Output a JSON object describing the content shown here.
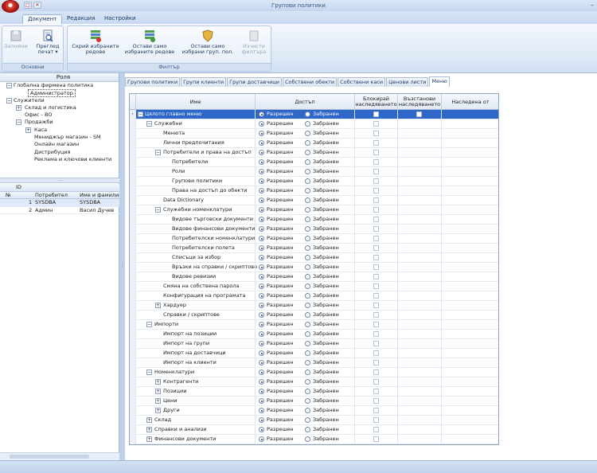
{
  "window": {
    "title": "Групови политики"
  },
  "ribbon": {
    "tabs": [
      "Документ",
      "Редакция",
      "Настройки"
    ],
    "groups": [
      {
        "label": "Основни",
        "buttons": [
          {
            "label": "Запомни",
            "disabled": true
          },
          {
            "label": "Преглед печат ▾",
            "disabled": false
          }
        ]
      },
      {
        "label": "Филтър",
        "buttons": [
          {
            "label": "Скрий избраните редове",
            "disabled": false
          },
          {
            "label": "Остави само избраните редове",
            "disabled": false
          },
          {
            "label": "Остави само избрани груп. пол.",
            "disabled": false
          },
          {
            "label": "Изчисти филтъра",
            "disabled": true
          }
        ]
      }
    ]
  },
  "left": {
    "header": "Роля",
    "tree": [
      {
        "label": "Глобална фирмена политика",
        "level": 0,
        "exp": "−",
        "selected": false
      },
      {
        "label": "Администратор",
        "level": 1,
        "exp": "",
        "selected": true
      },
      {
        "label": "Служители",
        "level": 0,
        "exp": "−",
        "selected": false
      },
      {
        "label": "Склад и логистика",
        "level": 1,
        "exp": "+",
        "selected": false
      },
      {
        "label": "Офис - ВО",
        "level": 1,
        "exp": "",
        "selected": false
      },
      {
        "label": "Продажби",
        "level": 1,
        "exp": "−",
        "selected": false
      },
      {
        "label": "Каса",
        "level": 2,
        "exp": "+",
        "selected": false
      },
      {
        "label": "Мениджър магазин - SM",
        "level": 2,
        "exp": "",
        "selected": false
      },
      {
        "label": "Онлайн магазин",
        "level": 2,
        "exp": "",
        "selected": false
      },
      {
        "label": "Дистрибуция",
        "level": 2,
        "exp": "",
        "selected": false
      },
      {
        "label": "Реклама и ключови клиенти",
        "level": 2,
        "exp": "",
        "selected": false
      }
    ],
    "users_grid": {
      "id_header": "ID",
      "columns": [
        "№",
        "Потребител",
        "Име и фамилия"
      ],
      "rows": [
        {
          "num": "1",
          "user": "SYSDBA",
          "name": "SYSDBA"
        },
        {
          "num": "2",
          "user": "Админ",
          "name": "Васил Дучев"
        }
      ]
    }
  },
  "tabs": [
    "Групови политики",
    "Групи клиенти",
    "Групи доставчици",
    "Собствени обекти",
    "Собствени каси",
    "Ценови листи",
    "Меню"
  ],
  "grid": {
    "columns": [
      "Име",
      "Достъп",
      "Блокирай наследяването",
      "Възстанови наследяването",
      "Наследена от"
    ],
    "allow_label": "Разрешен",
    "deny_label": "Забранен",
    "rows": [
      {
        "name": "Цялото главно меню",
        "level": 0,
        "exp": "−",
        "selected": true
      },
      {
        "name": "Служебни",
        "level": 1,
        "exp": "−"
      },
      {
        "name": "Менюта",
        "level": 2,
        "exp": ""
      },
      {
        "name": "Лични предпочитания",
        "level": 2,
        "exp": ""
      },
      {
        "name": "Потребители и права на достъп",
        "level": 2,
        "exp": "−"
      },
      {
        "name": "Потребители",
        "level": 3,
        "exp": ""
      },
      {
        "name": "Роли",
        "level": 3,
        "exp": ""
      },
      {
        "name": "Групови политики",
        "level": 3,
        "exp": ""
      },
      {
        "name": "Права на достъп до обекти",
        "level": 3,
        "exp": ""
      },
      {
        "name": "Data Dictionary",
        "level": 2,
        "exp": ""
      },
      {
        "name": "Служебни номенклатури",
        "level": 2,
        "exp": "−"
      },
      {
        "name": "Видове търговски документи",
        "level": 3,
        "exp": ""
      },
      {
        "name": "Видове финансови документи",
        "level": 3,
        "exp": ""
      },
      {
        "name": "Потребителски номенклатури",
        "level": 3,
        "exp": ""
      },
      {
        "name": "Потребителски полета",
        "level": 3,
        "exp": ""
      },
      {
        "name": "Списъци за избор",
        "level": 3,
        "exp": ""
      },
      {
        "name": "Връзки на справки / скриптове",
        "level": 3,
        "exp": ""
      },
      {
        "name": "Видове ревизии",
        "level": 3,
        "exp": ""
      },
      {
        "name": "Смяна на собствена парола",
        "level": 2,
        "exp": ""
      },
      {
        "name": "Конфигурация на програмата",
        "level": 2,
        "exp": ""
      },
      {
        "name": "Хардуер",
        "level": 2,
        "exp": "+"
      },
      {
        "name": "Справки / скриптове",
        "level": 2,
        "exp": ""
      },
      {
        "name": "Импорти",
        "level": 1,
        "exp": "−"
      },
      {
        "name": "Импорт на позиции",
        "level": 2,
        "exp": ""
      },
      {
        "name": "Импорт на групи",
        "level": 2,
        "exp": ""
      },
      {
        "name": "Импорт на доставчици",
        "level": 2,
        "exp": ""
      },
      {
        "name": "Импорт на клиенти",
        "level": 2,
        "exp": ""
      },
      {
        "name": "Номенклатури",
        "level": 1,
        "exp": "−"
      },
      {
        "name": "Контрагенти",
        "level": 2,
        "exp": "+"
      },
      {
        "name": "Позиции",
        "level": 2,
        "exp": "+"
      },
      {
        "name": "Цени",
        "level": 2,
        "exp": "+"
      },
      {
        "name": "Други",
        "level": 2,
        "exp": "+"
      },
      {
        "name": "Склад",
        "level": 1,
        "exp": "+"
      },
      {
        "name": "Справки и анализи",
        "level": 1,
        "exp": "+"
      },
      {
        "name": "Финансови документи",
        "level": 1,
        "exp": "+"
      }
    ]
  }
}
